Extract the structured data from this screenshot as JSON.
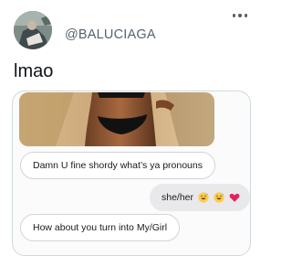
{
  "tweet": {
    "handle": "@BALUCIAGA",
    "text": "lmao"
  },
  "conversation": {
    "messages": [
      {
        "direction": "incoming",
        "text": "Damn U fine shordy what’s ya pronouns"
      },
      {
        "direction": "outgoing",
        "text": "she/her",
        "emojis": [
          "grinning-sweat-emoji",
          "grinning-sweat-emoji",
          "red-heart-emoji"
        ]
      },
      {
        "direction": "incoming",
        "text": "How about you turn into My/Girl"
      }
    ]
  },
  "colors": {
    "text_primary": "#0f1419",
    "text_secondary": "#536471",
    "card_border": "#cfd9de",
    "bubble_out": "#e9e9eb",
    "heart": "#e0245e"
  }
}
